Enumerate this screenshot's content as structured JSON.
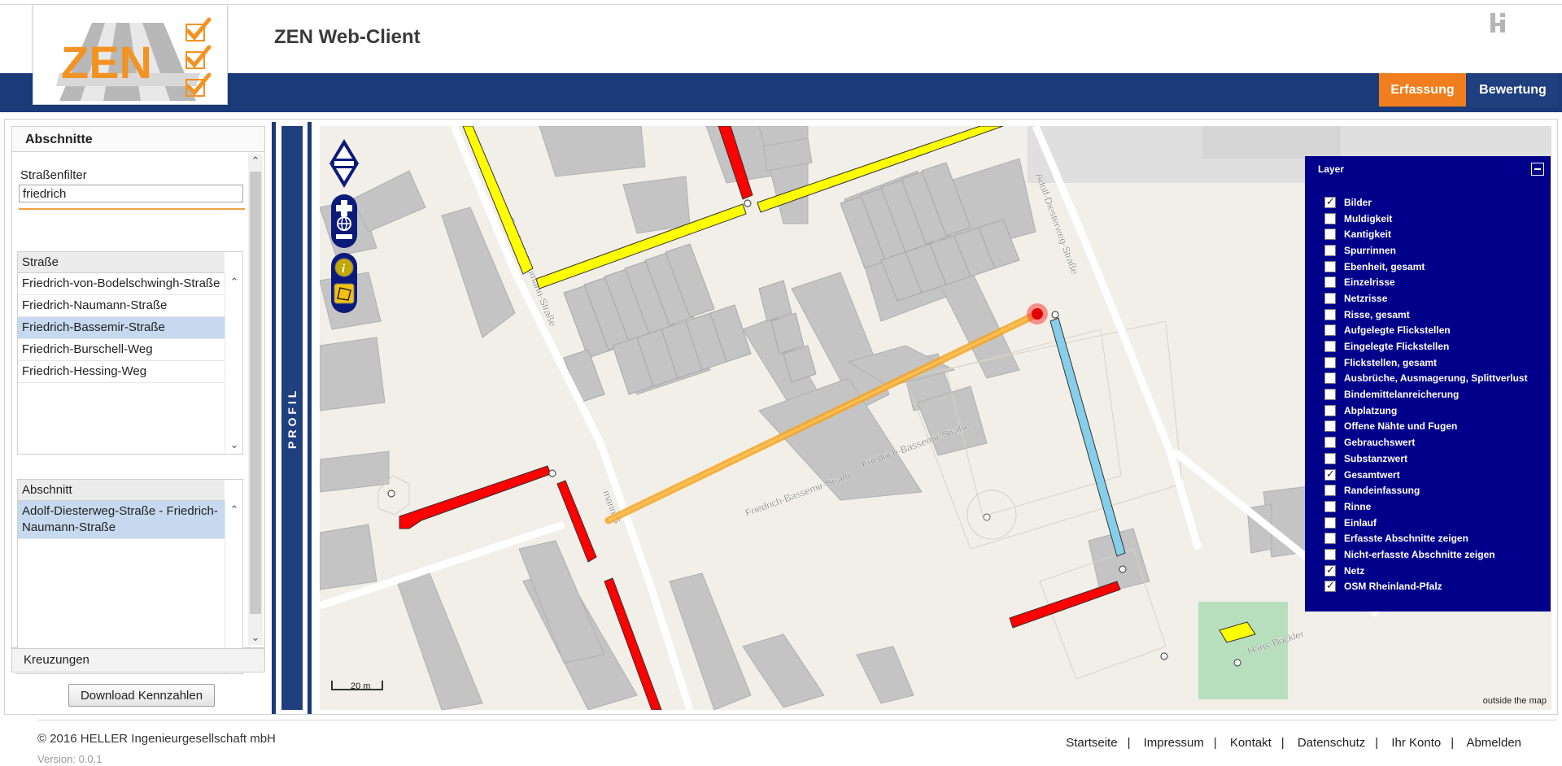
{
  "header": {
    "logo_text": "ZEN",
    "title": "ZEN Web-Client",
    "tabs": [
      {
        "label": "Erfassung",
        "active": true,
        "color": "#f07d1e"
      },
      {
        "label": "Bewertung",
        "active": false,
        "color": "#203f7e"
      }
    ],
    "brand_color": "#1b3a7a"
  },
  "left_panel": {
    "title": "Abschnitte",
    "filter_label": "Straßenfilter",
    "filter_value": "friedrich",
    "street_grid": {
      "header": "Straße",
      "rows": [
        "Friedrich-von-Bodelschwingh-Straße",
        "Friedrich-Naumann-Straße",
        "Friedrich-Bassemir-Straße",
        "Friedrich-Burschell-Weg",
        "Friedrich-Hessing-Weg"
      ],
      "selected_index": 2
    },
    "section_grid": {
      "header": "Abschnitt",
      "rows": [
        "Adolf-Diesterweg-Straße - Friedrich-Naumann-Straße"
      ],
      "selected_index": 0
    },
    "kreuzungen_label": "Kreuzungen",
    "download_button": "Download Kennzahlen"
  },
  "profil": {
    "label": "PROFIL"
  },
  "map": {
    "street_labels": {
      "naumann": "Friedrich-Naumann-Straße",
      "bassemir": "Friedrich-Bassemir-Straße",
      "diesterweg": "Adolf-Diesterweg-Straße",
      "hans": "Hans-Böckler",
      "mann_s": "mann-S"
    },
    "scale_label": "20 m",
    "outside_label": "outside the map",
    "segment_colors": {
      "good": "#ffff00",
      "bad": "#ff0000",
      "ok": "#87ceeb",
      "selected": "#f5a623"
    },
    "controls": [
      "pan-icon",
      "zoom-in-icon",
      "globe-icon",
      "zoom-out-icon",
      "info-icon",
      "polygon-select-icon"
    ]
  },
  "layers": {
    "title": "Layer",
    "items": [
      {
        "label": "Bilder",
        "checked": true
      },
      {
        "label": "Muldigkeit",
        "checked": false
      },
      {
        "label": "Kantigkeit",
        "checked": false
      },
      {
        "label": "Spurrinnen",
        "checked": false
      },
      {
        "label": "Ebenheit, gesamt",
        "checked": false
      },
      {
        "label": "Einzelrisse",
        "checked": false
      },
      {
        "label": "Netzrisse",
        "checked": false
      },
      {
        "label": "Risse, gesamt",
        "checked": false
      },
      {
        "label": "Aufgelegte Flickstellen",
        "checked": false
      },
      {
        "label": "Eingelegte Flickstellen",
        "checked": false
      },
      {
        "label": "Flickstellen, gesamt",
        "checked": false
      },
      {
        "label": "Ausbrüche, Ausmagerung, Splittverlust",
        "checked": false
      },
      {
        "label": "Bindemittelanreicherung",
        "checked": false
      },
      {
        "label": "Abplatzung",
        "checked": false
      },
      {
        "label": "Offene Nähte und Fugen",
        "checked": false
      },
      {
        "label": "Gebrauchswert",
        "checked": false
      },
      {
        "label": "Substanzwert",
        "checked": false
      },
      {
        "label": "Gesamtwert",
        "checked": true
      },
      {
        "label": "Randeinfassung",
        "checked": false
      },
      {
        "label": "Rinne",
        "checked": false
      },
      {
        "label": "Einlauf",
        "checked": false
      },
      {
        "label": "Erfasste Abschnitte zeigen",
        "checked": false
      },
      {
        "label": "Nicht-erfasste Abschnitte zeigen",
        "checked": false
      },
      {
        "label": "Netz",
        "checked": true
      },
      {
        "label": "OSM Rheinland-Pfalz",
        "checked": true
      }
    ]
  },
  "footer": {
    "copyright": "© 2016 HELLER Ingenieurgesellschaft mbH",
    "version": "Version: 0.0.1",
    "links": [
      "Startseite",
      "Impressum",
      "Kontakt",
      "Datenschutz",
      "Ihr Konto",
      "Abmelden"
    ]
  }
}
